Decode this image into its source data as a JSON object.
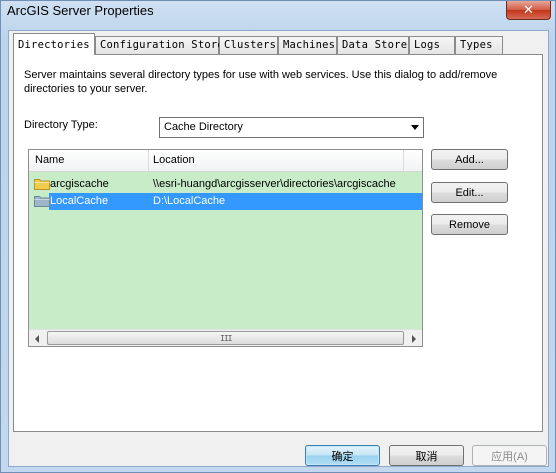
{
  "window": {
    "title": "ArcGIS Server Properties",
    "close_glyph": "✕"
  },
  "tabs": [
    {
      "label": "Directories",
      "active": true
    },
    {
      "label": "Configuration Store",
      "active": false
    },
    {
      "label": "Clusters",
      "active": false
    },
    {
      "label": "Machines",
      "active": false
    },
    {
      "label": "Data Store",
      "active": false
    },
    {
      "label": "Logs",
      "active": false
    },
    {
      "label": "Types",
      "active": false
    }
  ],
  "panel": {
    "intro": "Server maintains several directory types for use with web services. Use this dialog to add/remove directories to your server.",
    "directory_type_label": "Directory Type:",
    "directory_type_value": "Cache Directory",
    "columns": [
      "Name",
      "Location"
    ],
    "rows": [
      {
        "name": "arcgiscache",
        "location": "\\\\esri-huangd\\arcgisserver\\directories\\arcgiscache",
        "selected": false,
        "icon": "folder-icon"
      },
      {
        "name": "LocalCache",
        "location": "D:\\LocalCache",
        "selected": true,
        "icon": "folder-icon"
      }
    ],
    "scroll_grip": "III",
    "buttons": {
      "add": "Add...",
      "edit": "Edit...",
      "remove": "Remove"
    }
  },
  "footer": {
    "ok": "确定",
    "cancel": "取消",
    "apply": "应用(A)"
  },
  "colors": {
    "list_background": "#c8ecc8",
    "selection": "#3399ff",
    "folder_yellow": "#f2cc4e",
    "folder_gray": "#9fb6c8"
  }
}
